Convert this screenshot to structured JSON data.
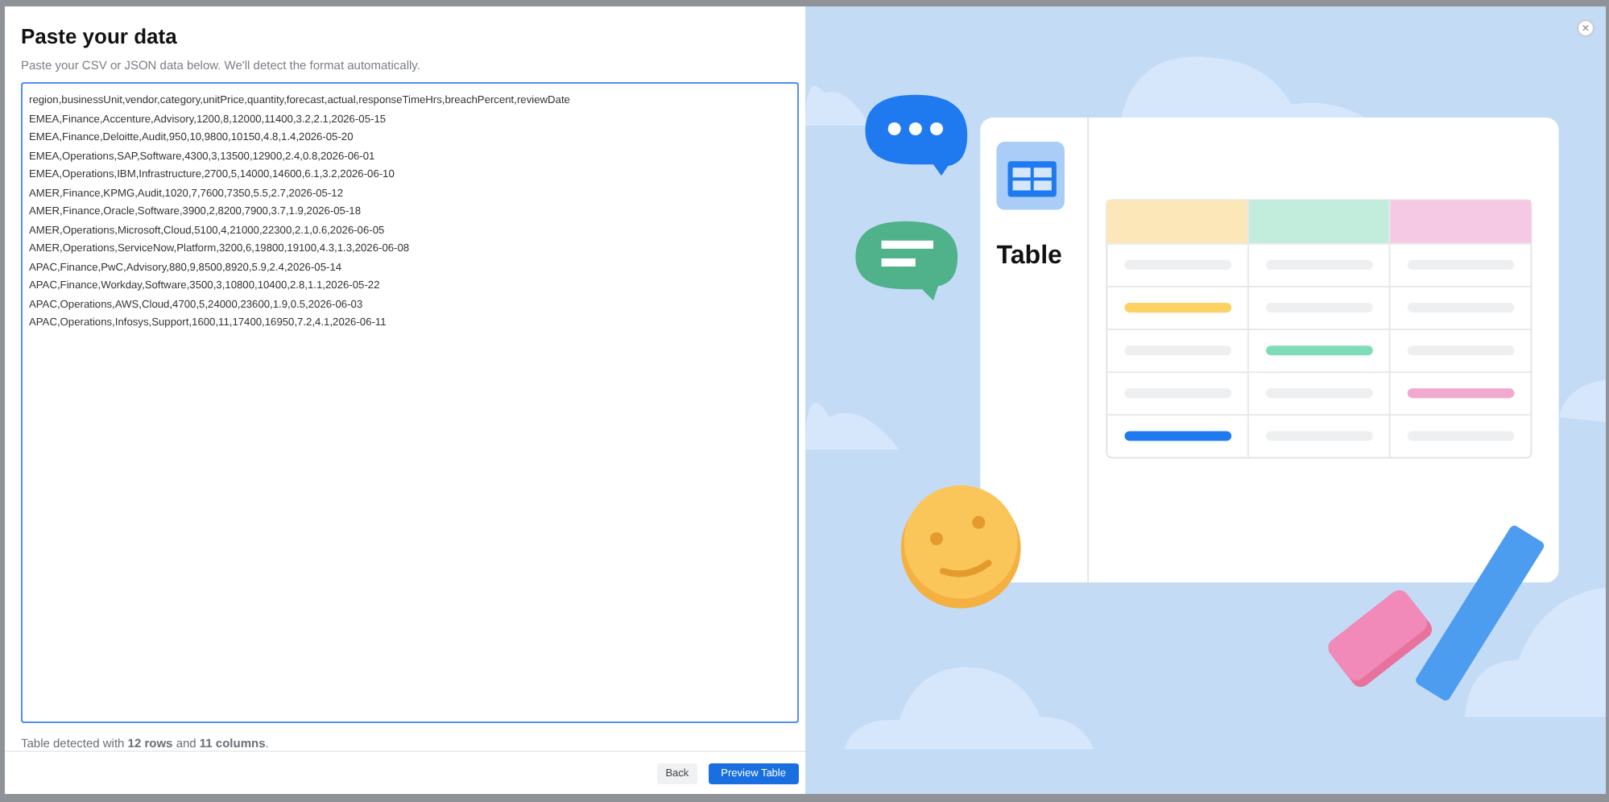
{
  "dialog": {
    "title": "Paste your data",
    "subtitle": "Paste your CSV or JSON data below. We'll detect the format automatically.",
    "input_lines": [
      "region,businessUnit,vendor,category,unitPrice,quantity,forecast,actual,responseTimeHrs,breachPercent,reviewDate",
      "EMEA,Finance,Accenture,Advisory,1200,8,12000,11400,3.2,2.1,2026-05-15",
      "EMEA,Finance,Deloitte,Audit,950,10,9800,10150,4.8,1.4,2026-05-20",
      "EMEA,Operations,SAP,Software,4300,3,13500,12900,2.4,0.8,2026-06-01",
      "EMEA,Operations,IBM,Infrastructure,2700,5,14000,14600,6.1,3.2,2026-06-10",
      "AMER,Finance,KPMG,Audit,1020,7,7600,7350,5.5,2.7,2026-05-12",
      "AMER,Finance,Oracle,Software,3900,2,8200,7900,3.7,1.9,2026-05-18",
      "AMER,Operations,Microsoft,Cloud,5100,4,21000,22300,2.1,0.6,2026-06-05",
      "AMER,Operations,ServiceNow,Platform,3200,6,19800,19100,4.3,1.3,2026-06-08",
      "APAC,Finance,PwC,Advisory,880,9,8500,8920,5.9,2.4,2026-05-14",
      "APAC,Finance,Workday,Software,3500,3,10800,10400,2.8,1.1,2026-05-22",
      "APAC,Operations,AWS,Cloud,4700,5,24000,23600,1.9,0.5,2026-06-03",
      "APAC,Operations,Infosys,Support,1600,11,17400,16950,7.2,4.1,2026-06-11"
    ],
    "detection": "Table detected with **12 rows** and **11 columns**.",
    "buttons": [
      {
        "label": "Back",
        "kind": "secondary"
      },
      {
        "label": "Preview Table",
        "kind": "primary"
      }
    ],
    "illustration": {
      "label": "Table"
    },
    "close": "×"
  }
}
